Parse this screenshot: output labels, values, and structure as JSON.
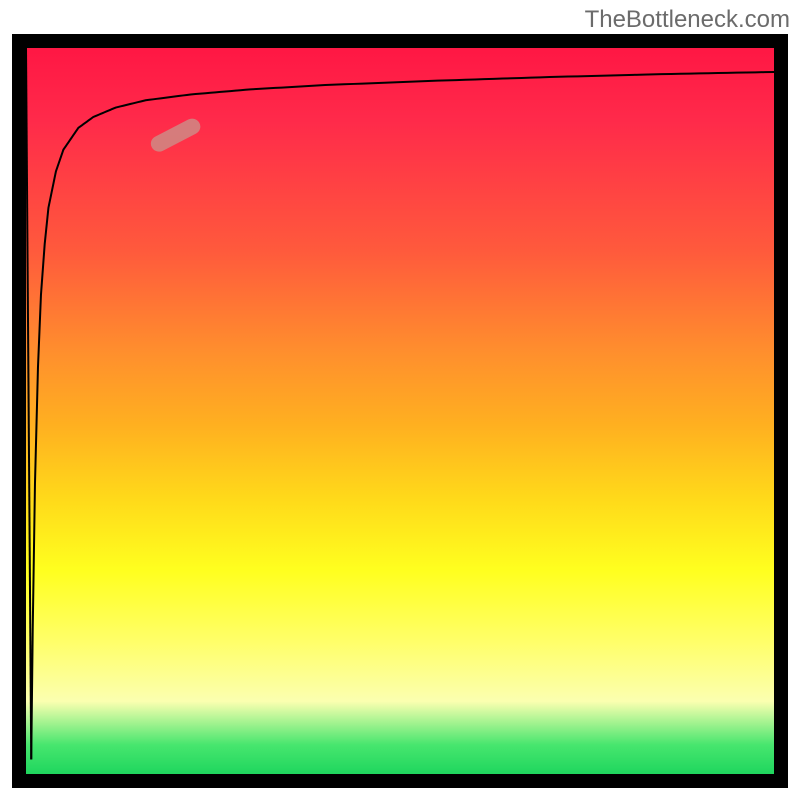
{
  "watermark": "TheBottleneck.com",
  "colors": {
    "frame": "#000000",
    "curve": "#000000",
    "marker_fill": "#cf8a85",
    "gradient_top": "#ff1744",
    "gradient_mid1": "#ff8f2d",
    "gradient_mid2": "#ffff1f",
    "gradient_bottom": "#1fd65e",
    "watermark_text": "#6b6b6b"
  },
  "chart_data": {
    "type": "line",
    "title": "",
    "xlabel": "",
    "ylabel": "",
    "xlim": [
      0,
      100
    ],
    "ylim": [
      0,
      100
    ],
    "series": [
      {
        "name": "curve",
        "x": [
          0.7,
          0.9,
          1.2,
          1.6,
          2.0,
          2.5,
          3.0,
          4.0,
          5.0,
          7.0,
          9.0,
          12.0,
          16.0,
          22.0,
          30.0,
          40.0,
          55.0,
          70.0,
          85.0,
          100.0
        ],
        "y": [
          2.0,
          20.0,
          40.0,
          56.0,
          66.0,
          73.0,
          78.0,
          83.0,
          86.0,
          89.0,
          90.5,
          91.8,
          92.8,
          93.6,
          94.3,
          94.9,
          95.5,
          96.0,
          96.4,
          96.7
        ]
      },
      {
        "name": "down-stroke",
        "x": [
          0.0,
          0.7
        ],
        "y": [
          100.0,
          2.0
        ]
      }
    ],
    "marker": {
      "x_range": [
        17,
        23
      ],
      "y_range": [
        85,
        91
      ],
      "shape": "pill",
      "angle_deg": -28
    },
    "background_gradient": {
      "direction": "vertical",
      "stops": [
        {
          "pos": 0.0,
          "color": "#ff1744"
        },
        {
          "pos": 0.42,
          "color": "#ff8f2d"
        },
        {
          "pos": 0.72,
          "color": "#ffff1f"
        },
        {
          "pos": 0.96,
          "color": "#47e66e"
        },
        {
          "pos": 1.0,
          "color": "#1fd65e"
        }
      ]
    }
  }
}
